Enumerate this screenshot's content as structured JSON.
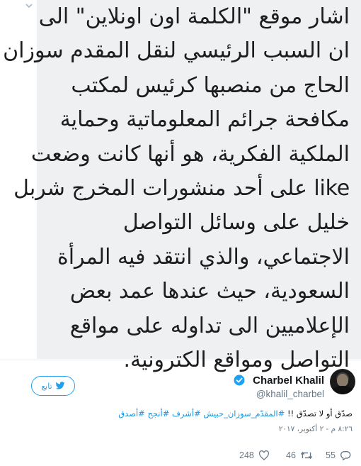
{
  "image_card": {
    "lines": [
      "اشار موقع \"الكلمة اون اونلاين\" الى",
      "ان السبب الرئيسي لنقل المقدم سوزان",
      "الحاج من منصبها كرئيس لمكتب",
      "مكافحة جرائم المعلوماتية وحماية",
      "الملكية الفكرية، هو أنها كانت وضعت",
      "like على أحد منشورات المخرج شربل",
      "خليل على وسائل التواصل",
      "الاجتماعي، والذي انتقد فيه المرأة",
      "السعودية، حيث عندها عمد بعض",
      "الإعلاميين الى تداوله على مواقع",
      "التواصل ومواقع الكترونية."
    ],
    "chevron_icon": "chevron-down-icon",
    "background": "#eef0f2"
  },
  "tweet": {
    "display_name": "Charbel Khalil",
    "handle": "@khalil_charbel",
    "follow_label": "تابع",
    "body_plain": "صدّق أو لا تصدّق !!",
    "body_hashtags": "#المقدّم_سوزان_حبيش #أشرف #أنجح #أصدق",
    "timestamp": "٨:٢٦ م - ٢ أكتوبر، ٢٠١٧",
    "actions": {
      "reply_count": "55",
      "retweet_count": "46",
      "like_count": "248"
    },
    "colors": {
      "accent": "#1da1f2",
      "hashtag": "#1b95e0",
      "muted": "#657786",
      "text": "#14171a"
    }
  }
}
